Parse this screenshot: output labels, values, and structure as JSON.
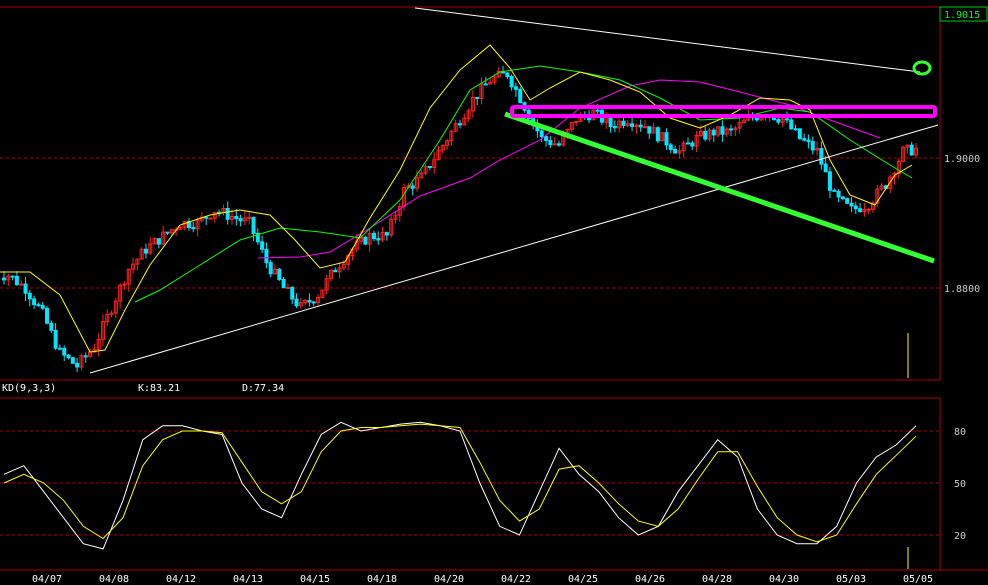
{
  "chart_data": [
    {
      "type": "candlestick",
      "title": "",
      "ylim": [
        1.866,
        1.9025
      ],
      "y_ticks": [
        "1.9000",
        "1.8800"
      ],
      "last_price_label": "1.9015",
      "x_labels": [
        "04/07",
        "04/08",
        "04/12",
        "04/13",
        "04/15",
        "04/18",
        "04/20",
        "04/22",
        "04/25",
        "04/26",
        "04/28",
        "04/30",
        "05/03",
        "05/05"
      ],
      "close": [
        1.882,
        1.88,
        1.876,
        1.87,
        1.868,
        1.871,
        1.877,
        1.883,
        1.886,
        1.888,
        1.89,
        1.89,
        1.892,
        1.891,
        1.89,
        1.884,
        1.88,
        1.877,
        1.879,
        1.883,
        1.886,
        1.888,
        1.888,
        1.895,
        1.897,
        1.901,
        1.905,
        1.909,
        1.912,
        1.913,
        1.908,
        1.903,
        1.902,
        1.906,
        1.907,
        1.905,
        1.906,
        1.905,
        1.903,
        1.901,
        1.903,
        1.904,
        1.904,
        1.906,
        1.907,
        1.906,
        1.903,
        1.901,
        1.894,
        1.892,
        1.893,
        1.896,
        1.901,
        1.9015
      ],
      "series": [
        {
          "name": "MA (yellow)",
          "color": "#ffff00"
        },
        {
          "name": "MA (green)",
          "color": "#00ff00"
        },
        {
          "name": "MA (magenta)",
          "color": "#ff00ff"
        }
      ],
      "annotations": [
        {
          "kind": "resistance-band",
          "color": "#ff00ff",
          "y": 1.9045
        },
        {
          "kind": "descending-trendline",
          "color": "#33ff33"
        },
        {
          "kind": "trendline",
          "color": "#ffffff"
        },
        {
          "kind": "circle-marker",
          "color": "#33ff33"
        }
      ]
    },
    {
      "type": "line",
      "title": "KD(9,3,3)",
      "k_label": "K:83.21",
      "d_label": "D:77.34",
      "ylim": [
        8,
        100
      ],
      "y_ticks": [
        "80",
        "50",
        "20"
      ],
      "x_labels": [
        "04/07",
        "04/08",
        "04/12",
        "04/13",
        "04/15",
        "04/18",
        "04/20",
        "04/22",
        "04/25",
        "04/26",
        "04/28",
        "04/30",
        "05/03",
        "05/05"
      ],
      "series": [
        {
          "name": "K",
          "color": "#ffffff",
          "values": [
            55,
            60,
            45,
            30,
            15,
            12,
            40,
            75,
            83,
            83,
            80,
            78,
            50,
            35,
            30,
            55,
            78,
            85,
            80,
            82,
            84,
            85,
            83,
            80,
            50,
            25,
            20,
            45,
            70,
            55,
            45,
            30,
            20,
            25,
            45,
            60,
            75,
            65,
            35,
            20,
            15,
            15,
            25,
            50,
            65,
            72,
            83
          ]
        },
        {
          "name": "D",
          "color": "#ffff00",
          "values": [
            50,
            55,
            50,
            40,
            25,
            18,
            30,
            60,
            75,
            80,
            80,
            79,
            62,
            45,
            38,
            45,
            68,
            80,
            82,
            82,
            83,
            84,
            83,
            82,
            62,
            40,
            28,
            35,
            58,
            60,
            50,
            38,
            28,
            25,
            35,
            52,
            68,
            68,
            48,
            30,
            20,
            16,
            20,
            38,
            55,
            66,
            77
          ]
        }
      ]
    }
  ]
}
